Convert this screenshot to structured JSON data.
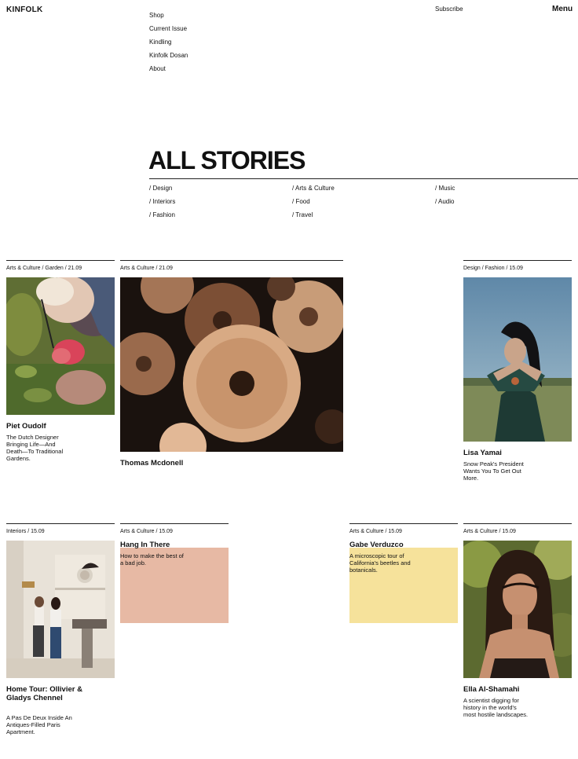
{
  "brand": {
    "logo": "KINFOLK"
  },
  "header": {
    "nav": [
      "Shop",
      "Current Issue",
      "Kindling",
      "Kinfolk Dosan",
      "About"
    ],
    "subscribe": "Subscribe",
    "menu": "Menu"
  },
  "stories": {
    "heading": "ALL STORIES",
    "categories": [
      "/ Design",
      "/ Interiors",
      "/ Fashion",
      "/ Arts & Culture",
      "/ Food",
      "/ Travel",
      "/ Music",
      "/ Audio"
    ]
  },
  "cards": [
    {
      "meta": "Arts & Culture / Garden / 21.09",
      "title": "Piet Oudolf",
      "dek": "The Dutch Designer Bringing Life—And Death—To Traditional Gardens."
    },
    {
      "meta": "Arts & Culture / 21.09",
      "title": "Thomas Mcdonell"
    },
    {
      "meta": "Design / Fashion / 15.09",
      "title": "Lisa Yamai",
      "dek": "Snow Peak's President Wants You To Get Out More."
    },
    {
      "meta": "Interiors / 15.09",
      "title": "Home Tour: Ollivier & Gladys Chennel",
      "dek": "A Pas De Deux Inside An Antiques-Filled Paris Apartment."
    },
    {
      "meta": "Arts & Culture / 15.09",
      "title": "Hang In There",
      "dek": "How to make the best of a bad job.",
      "color": "#e7b9a4"
    },
    {
      "meta": "Arts & Culture / 15.09",
      "title": "Gabe Verduzco",
      "dek": "A microscopic tour of California's beetles and botanicals.",
      "color": "#f6e29b"
    },
    {
      "meta": "Arts & Culture / 15.09",
      "title": "Ella Al-Shamahi",
      "dek": "A scientist digging for history in the world's most hostile landscapes."
    }
  ]
}
